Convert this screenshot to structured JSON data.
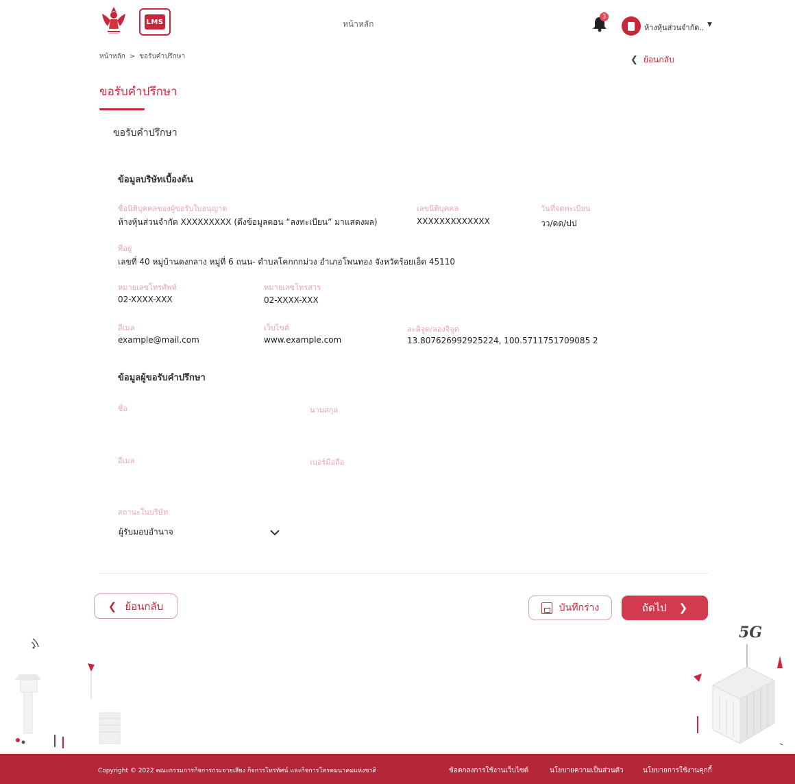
{
  "header": {
    "brand_lms": "LMS",
    "nav_home": "หน้าหลัก",
    "notification_count": "3",
    "company_name": "ห้างหุ้นส่วนจำกัด..",
    "colors": {
      "primary": "#c8263a",
      "label": "#e8a6ae",
      "footer": "#b52638"
    }
  },
  "breadcrumb": {
    "home": "หน้าหลัก",
    "separator": ">",
    "current": "ขอรับคำปรึกษา"
  },
  "back_link": "ย้อนกลับ",
  "page_title": "ขอรับคำปรึกษา",
  "section_heading": "ขอรับคำปรึกษา",
  "company_info": {
    "title": "ข้อมูลบริษัทเบื้องต้น",
    "licensee_label": "ชื่อนิติบุคคลของผู้ขอรับใบอนุญาต",
    "licensee_value": "ห้างหุ้นส่วนจำกัด XXXXXXXXX (ดึงข้อมูลตอน “ลงทะเบียน” มาแสดงผล)",
    "juristic_id_label": "เลขนิติบุคคล",
    "juristic_id_value": "XXXXXXXXXXXXX",
    "reg_date_label": "วันที่จดทะเบียน",
    "reg_date_value": "วว/ดด/ปป",
    "address_label": "ที่อยู่",
    "address_value": "เลขที่ 40 หมู่บ้านดงกลาง หมู่ที่ 6 ถนน- ตำบลโคกกกม่วง อำเภอโพนทอง จังหวัดร้อยเอ็ด 45110",
    "phone_label": "หมายเลขโทรศัพท์",
    "phone_value": "02-XXXX-XXX",
    "fax_label": "หมายเลขโทรสาร",
    "fax_value": "02-XXXX-XXX",
    "email_label": "อีเมล",
    "email_value": "example@mail.com",
    "website_label": "เว็บไซต์",
    "website_value": "www.example.com",
    "latlng_label": "ละติจูด/ลองจิจูด",
    "latlng_value": "13.807626992925224, 100.5711751709085 2"
  },
  "requester_info": {
    "title": "ข้อมูลผู้ขอรับคำปรึกษา",
    "name_label": "ชื่อ",
    "surname_label": "นามสกุล",
    "email_label": "อีเมล",
    "mobile_label": "เบอร์มือถือ",
    "position_label": "สถานะในบริษัท",
    "position_value": "ผู้รับมอบอำนาจ"
  },
  "actions": {
    "back": "ย้อนกลับ",
    "save_draft": "บันทึกร่าง",
    "next": "ถัดไป"
  },
  "illustration": {
    "label_5g": "5G"
  },
  "footer": {
    "copyright": "Copyright © 2022 คณะกรรมการกิจการกระจายเสียง กิจการโทรทัศน์ และกิจการโทรคมนาคมแห่งชาติ",
    "link_terms": "ข้อตกลงการใช้งานเว็บไซต์",
    "link_privacy": "นโยบายความเป็นส่วนตัว",
    "link_cookie": "นโยบายการใช้งานคุกกี้"
  }
}
